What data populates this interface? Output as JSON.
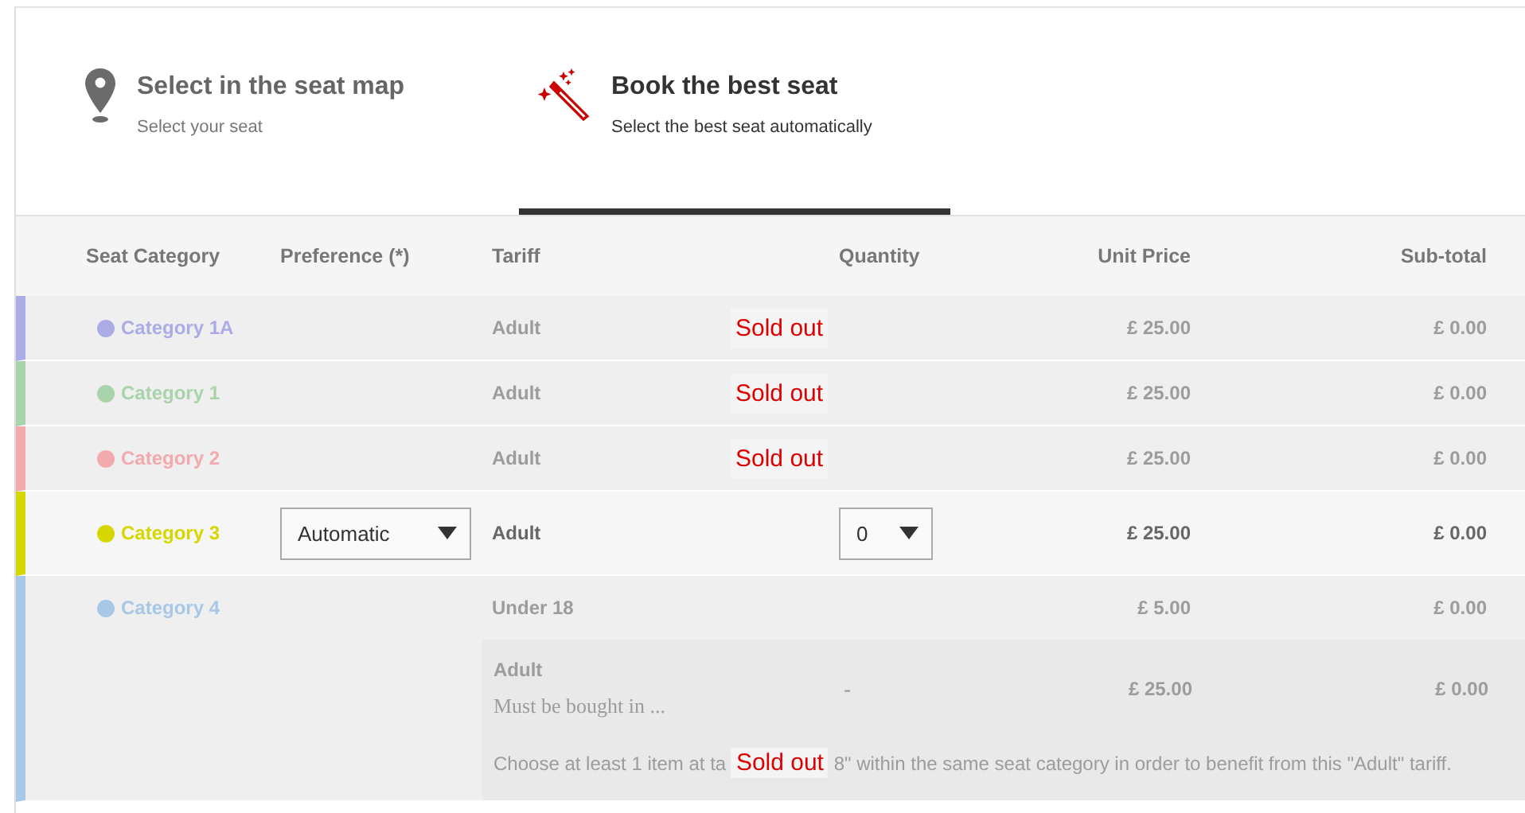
{
  "tabs": [
    {
      "kind": "pin",
      "title": "Select in the seat map",
      "subtitle": "Select your seat",
      "selected": false
    },
    {
      "kind": "wand",
      "title": "Book the best seat",
      "subtitle": "Select the best seat automatically",
      "selected": true
    }
  ],
  "table": {
    "columns": [
      "Seat Category",
      "Preference (*)",
      "Tariff",
      "Quantity",
      "Unit Price",
      "Sub-total"
    ],
    "rows": [
      {
        "category": "Category 1A",
        "color": "#ababe6",
        "disabled": true,
        "tariffs": [
          {
            "name": "Adult",
            "sold_out": "Sold out",
            "unit_price": "£ 25.00",
            "subtotal": "£ 0.00"
          }
        ]
      },
      {
        "category": "Category 1",
        "color": "#a9d3ab",
        "disabled": true,
        "tariffs": [
          {
            "name": "Adult",
            "sold_out": "Sold out",
            "unit_price": "£ 25.00",
            "subtotal": "£ 0.00"
          }
        ]
      },
      {
        "category": "Category 2",
        "color": "#f2aaae",
        "disabled": true,
        "tariffs": [
          {
            "name": "Adult",
            "sold_out": "Sold out",
            "unit_price": "£ 25.00",
            "subtotal": "£ 0.00"
          }
        ]
      },
      {
        "category": "Category 3",
        "color": "#d6d600",
        "disabled": false,
        "preference": "Automatic",
        "tariffs": [
          {
            "name": "Adult",
            "quantity": "0",
            "unit_price": "£ 25.00",
            "subtotal": "£ 0.00"
          }
        ]
      },
      {
        "category": "Category 4",
        "color": "#a8c8e8",
        "disabled": true,
        "tariffs": [
          {
            "name": "Under 18",
            "unit_price": "£ 5.00",
            "subtotal": "£ 0.00"
          },
          {
            "name": "Adult",
            "detail": "Must be bought in ...",
            "quantity_text": "-",
            "unit_price": "£ 25.00",
            "subtotal": "£ 0.00",
            "note_start": "Choose at least 1 item at ta",
            "sold_out": "Sold out",
            "note_end": "8\" within the same seat category in order to benefit from this \"Adult\" tariff."
          }
        ]
      }
    ]
  }
}
